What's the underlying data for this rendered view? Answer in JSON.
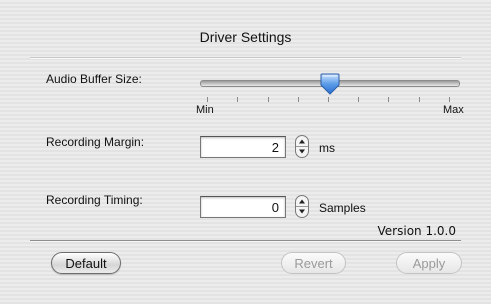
{
  "window": {
    "title": "Driver Settings"
  },
  "audio_buffer": {
    "label": "Audio Buffer Size:",
    "min_label": "Min",
    "max_label": "Max",
    "value_fraction": 0.5
  },
  "recording_margin": {
    "label": "Recording Margin:",
    "value": "2",
    "unit": "ms"
  },
  "recording_timing": {
    "label": "Recording Timing:",
    "value": "0",
    "unit": "Samples"
  },
  "version": "Version 1.0.0",
  "buttons": {
    "default": "Default",
    "revert": "Revert",
    "apply": "Apply"
  },
  "colors": {
    "slider_thumb": "#5b9ce8",
    "disabled_text": "#9a9a9a"
  }
}
